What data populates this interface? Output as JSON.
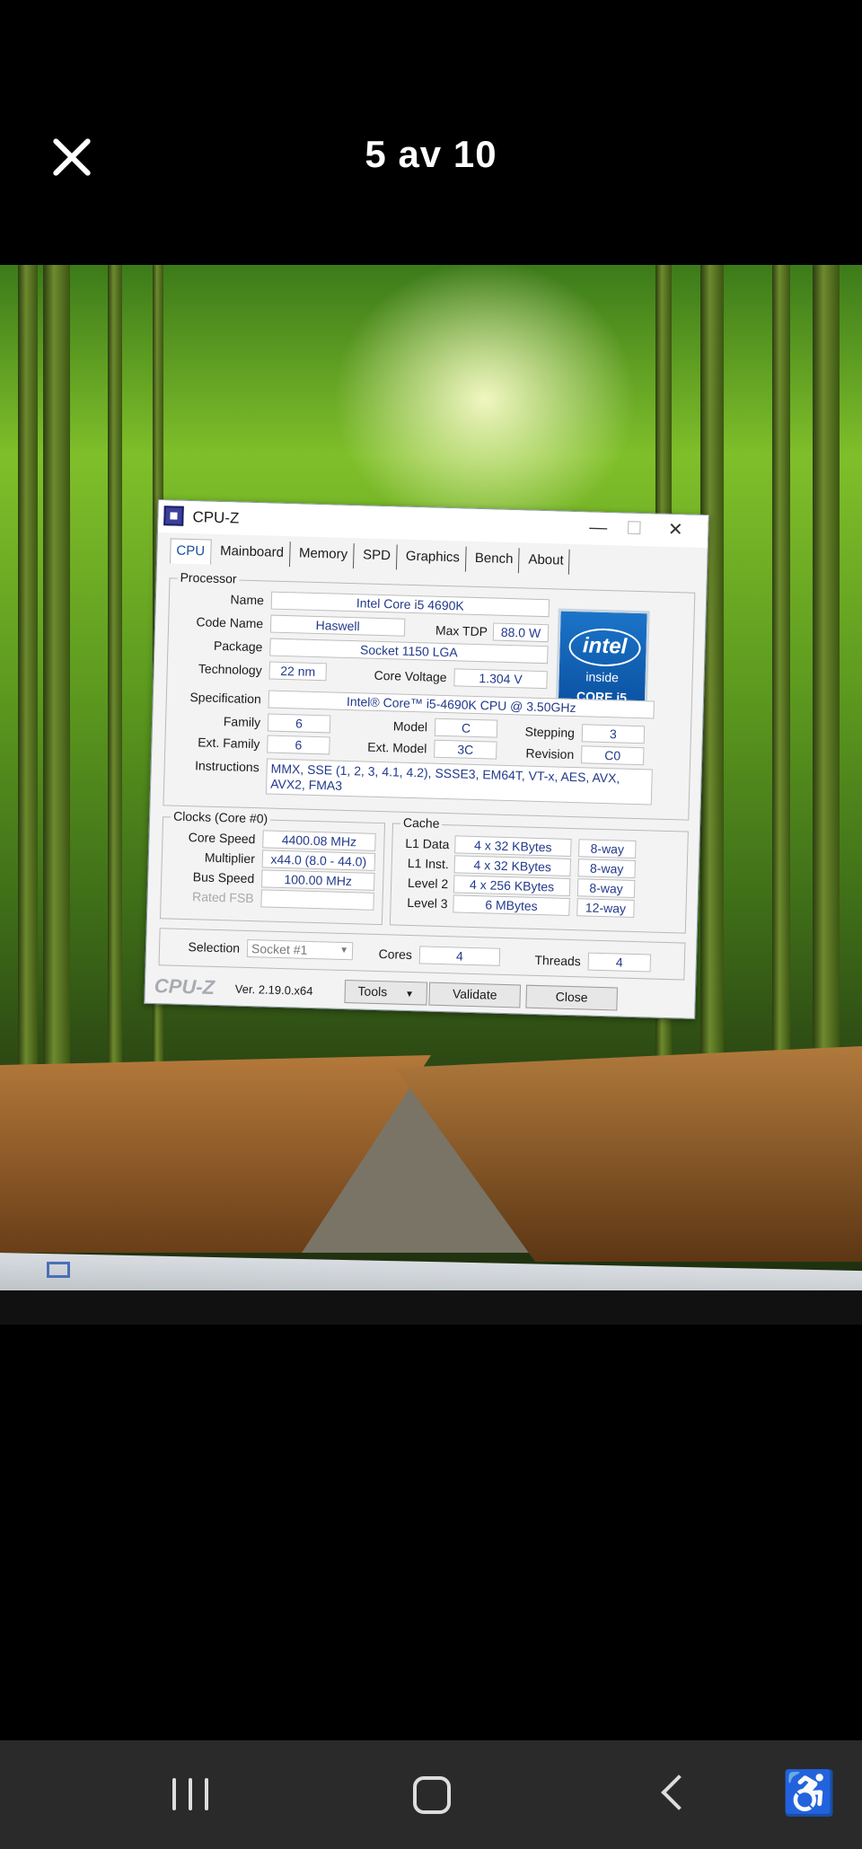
{
  "viewer": {
    "counter": "5 av 10"
  },
  "window": {
    "title": "CPU-Z",
    "minimize": "—",
    "maximize": "☐",
    "close": "✕",
    "tabs": [
      "CPU",
      "Mainboard",
      "Memory",
      "SPD",
      "Graphics",
      "Bench",
      "About"
    ],
    "processor": {
      "group": "Processor",
      "name_label": "Name",
      "name": "Intel Core i5 4690K",
      "codename_label": "Code Name",
      "codename": "Haswell",
      "maxtdp_label": "Max TDP",
      "maxtdp": "88.0 W",
      "package_label": "Package",
      "package": "Socket 1150 LGA",
      "technology_label": "Technology",
      "technology": "22 nm",
      "corevoltage_label": "Core Voltage",
      "corevoltage": "1.304 V",
      "spec_label": "Specification",
      "spec": "Intel® Core™ i5-4690K CPU @ 3.50GHz",
      "family_label": "Family",
      "family": "6",
      "model_label": "Model",
      "model": "C",
      "stepping_label": "Stepping",
      "stepping": "3",
      "extfamily_label": "Ext. Family",
      "extfamily": "6",
      "extmodel_label": "Ext. Model",
      "extmodel": "3C",
      "revision_label": "Revision",
      "revision": "C0",
      "instructions_label": "Instructions",
      "instructions": "MMX, SSE (1, 2, 3, 4.1, 4.2), SSSE3, EM64T, VT-x, AES, AVX, AVX2, FMA3"
    },
    "badge": {
      "brand": "intel",
      "inside": "inside",
      "line": "CORE i5"
    },
    "clocks": {
      "group": "Clocks (Core #0)",
      "corespeed_label": "Core Speed",
      "corespeed": "4400.08 MHz",
      "multiplier_label": "Multiplier",
      "multiplier": "x44.0 (8.0 - 44.0)",
      "busspeed_label": "Bus Speed",
      "busspeed": "100.00 MHz",
      "ratedfsb_label": "Rated FSB",
      "ratedfsb": ""
    },
    "cache": {
      "group": "Cache",
      "l1data_label": "L1 Data",
      "l1data": "4 x 32 KBytes",
      "l1data_way": "8-way",
      "l1inst_label": "L1 Inst.",
      "l1inst": "4 x 32 KBytes",
      "l1inst_way": "8-way",
      "l2_label": "Level 2",
      "l2": "4 x 256 KBytes",
      "l2_way": "8-way",
      "l3_label": "Level 3",
      "l3": "6 MBytes",
      "l3_way": "12-way"
    },
    "selection": {
      "label": "Selection",
      "value": "Socket #1",
      "cores_label": "Cores",
      "cores": "4",
      "threads_label": "Threads",
      "threads": "4"
    },
    "footer": {
      "logo": "CPU-Z",
      "version": "Ver. 2.19.0.x64",
      "tools": "Tools",
      "validate": "Validate",
      "close": "Close"
    }
  }
}
